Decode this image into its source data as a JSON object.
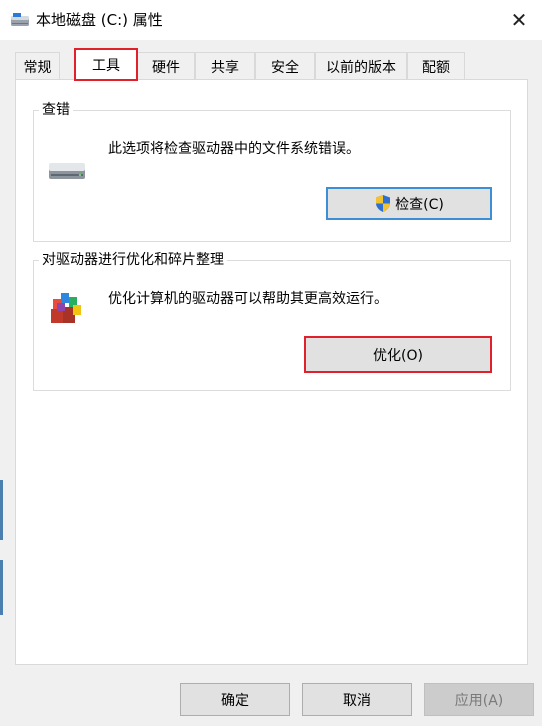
{
  "window": {
    "title": "本地磁盘 (C:) 属性",
    "close_glyph": "✕"
  },
  "tabs": [
    {
      "label": "常规"
    },
    {
      "label": "工具",
      "active": true
    },
    {
      "label": "硬件"
    },
    {
      "label": "共享"
    },
    {
      "label": "安全"
    },
    {
      "label": "以前的版本"
    },
    {
      "label": "配额"
    }
  ],
  "error_checking": {
    "title": "查错",
    "description": "此选项将检查驱动器中的文件系统错误。",
    "button_label": "检查(C)",
    "icon": "drive-icon"
  },
  "optimize": {
    "title": "对驱动器进行优化和碎片整理",
    "description": "优化计算机的驱动器可以帮助其更高效运行。",
    "button_label": "优化(O)",
    "icon": "defrag-icon"
  },
  "footer": {
    "ok_label": "确定",
    "cancel_label": "取消",
    "apply_label": "应用(A)"
  },
  "colors": {
    "highlight_red": "#e0202a",
    "focus_blue": "#3c8fd6",
    "window_bg": "#f0f0f0"
  }
}
